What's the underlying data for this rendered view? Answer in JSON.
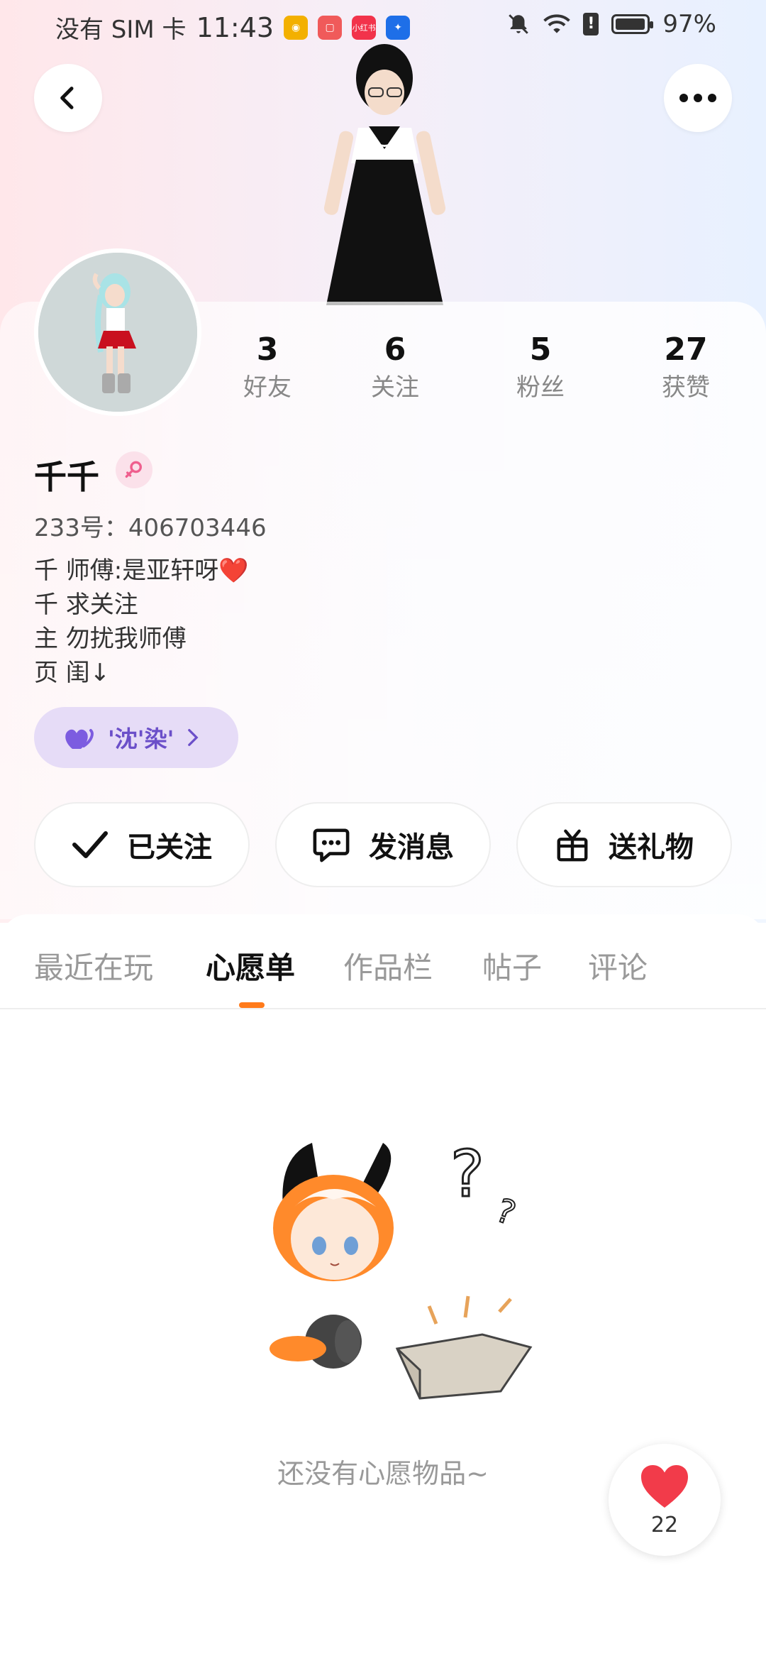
{
  "status_bar": {
    "carrier": "没有 SIM 卡",
    "time": "11:43",
    "app_badge_1": "小红书",
    "battery": "97%",
    "battery_level": 0.97
  },
  "header": {
    "back_icon": "chevron-left-icon",
    "more_icon": "more-dots-icon"
  },
  "profile": {
    "name": "千千",
    "gender_icon": "female-icon",
    "uid": "233号：406703446",
    "bio_lines": [
      "千 师傅:是亚轩呀❤️",
      "千 求关注",
      "主 勿扰我师傅",
      "页 闺↓"
    ],
    "tag_label": "'沈'染'"
  },
  "stats": [
    {
      "value": "3",
      "label": "好友"
    },
    {
      "value": "6",
      "label": "关注"
    },
    {
      "value": "5",
      "label": "粉丝"
    },
    {
      "value": "27",
      "label": "获赞"
    }
  ],
  "actions": {
    "followed": "已关注",
    "message": "发消息",
    "gift": "送礼物"
  },
  "tabs": [
    {
      "label": "最近在玩",
      "active": false
    },
    {
      "label": "心愿单",
      "active": true
    },
    {
      "label": "作品栏",
      "active": false
    },
    {
      "label": "帖子",
      "active": false
    },
    {
      "label": "评论",
      "active": false
    }
  ],
  "empty_state": {
    "text": "还没有心愿物品~"
  },
  "like": {
    "count": "22"
  },
  "colors": {
    "accent": "#ff7a1a",
    "tag_bg": "#e6dcf7",
    "tag_text": "#6b4fc9",
    "heart": "#f23b4a"
  }
}
